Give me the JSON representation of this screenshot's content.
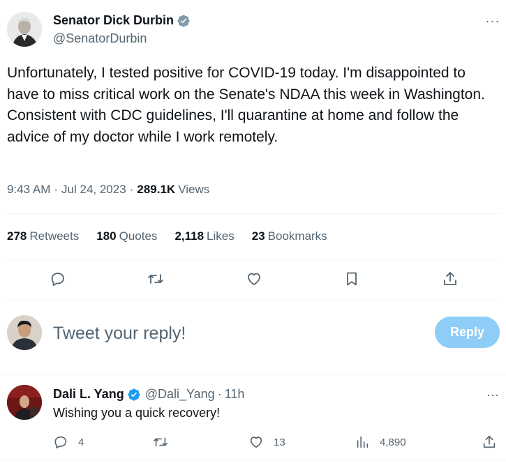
{
  "tweet": {
    "author_name": "Senator Dick Durbin",
    "author_handle": "@SenatorDurbin",
    "body_lines": [
      "Unfortunately, I tested positive for COVID-19 today. I'm disappointed to have to miss critical work on the Senate's NDAA this week in Washington.",
      "Consistent with CDC guidelines, I'll quarantine at home and follow the advice of my doctor while I work remotely."
    ],
    "time": "9:43 AM",
    "date": "Jul 24, 2023",
    "separator": "·",
    "views_count": "289.1K",
    "views_label": "Views",
    "more_label": "···"
  },
  "stats": [
    {
      "num": "278",
      "label": "Retweets"
    },
    {
      "num": "180",
      "label": "Quotes"
    },
    {
      "num": "2,118",
      "label": "Likes"
    },
    {
      "num": "23",
      "label": "Bookmarks"
    }
  ],
  "icons": {
    "reply": "reply-icon",
    "retweet": "retweet-icon",
    "like": "heart-icon",
    "bookmark": "bookmark-icon",
    "share": "share-icon",
    "views": "analytics-icon",
    "verified": "verified-badge-icon"
  },
  "composer": {
    "placeholder": "Tweet your reply!",
    "button_label": "Reply"
  },
  "reply": {
    "name": "Dali L. Yang",
    "handle": "@Dali_Yang",
    "separator": "·",
    "time": "11h",
    "text": "Wishing you a quick recovery!",
    "reply_count": "4",
    "like_count": "13",
    "views_count": "4,890",
    "more_label": "···"
  },
  "colors": {
    "accent": "#1d9bf0",
    "reply_button_disabled": "#8ecdf7",
    "muted": "#536471",
    "text": "#0f1419",
    "divider": "#eff3f4"
  }
}
